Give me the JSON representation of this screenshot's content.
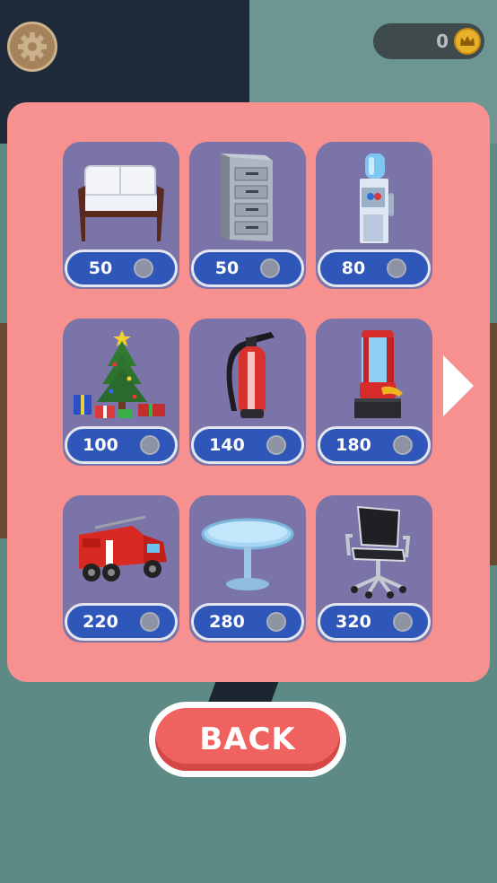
{
  "hud": {
    "settings_icon": "gear-icon",
    "coins": "0",
    "coin_icon": "crown-coin-icon"
  },
  "shop": {
    "items": [
      {
        "name": "sofa",
        "price": "50"
      },
      {
        "name": "filing-cabinet",
        "price": "50"
      },
      {
        "name": "water-cooler",
        "price": "80"
      },
      {
        "name": "christmas-tree",
        "price": "100"
      },
      {
        "name": "fire-extinguisher",
        "price": "140"
      },
      {
        "name": "claw-machine",
        "price": "180"
      },
      {
        "name": "fire-truck",
        "price": "220"
      },
      {
        "name": "round-table",
        "price": "280"
      },
      {
        "name": "office-chair",
        "price": "320"
      }
    ],
    "next_icon": "chevron-right-icon"
  },
  "back_label": "BACK",
  "colors": {
    "panel": "#f7918f",
    "card": "#7b74a8",
    "price_button": "#2f56b9",
    "back_button": "#f0625f"
  }
}
